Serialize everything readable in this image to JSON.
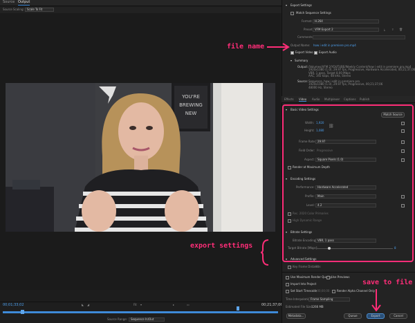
{
  "left": {
    "tabs": [
      "Source",
      "Output"
    ],
    "source_scaling_label": "Source Scaling:",
    "source_scaling_value": "Scale To Fit",
    "timecode_start": "00;01;33;02",
    "timecode_end": "00;21;37;06",
    "fit_label": "Fit",
    "source_range_label": "Source Range:",
    "source_range_value": "Sequence In/Out",
    "poster": {
      "line1": "YOU'RE",
      "line2": "BREWING",
      "line3": "NEW"
    }
  },
  "export": {
    "header": "Export Settings",
    "match_seq": "Match Sequence Settings",
    "format_label": "Format:",
    "format_value": "H.264",
    "preset_label": "Preset:",
    "preset_value": "VFM Export 2",
    "comments_label": "Comments:",
    "output_name_label": "Output Name:",
    "output_name_value": "how i edit in premiere pro.mp4",
    "export_video": "Export Video",
    "export_audio": "Export Audio",
    "summary_header": "Summary",
    "output_label": "Output:",
    "output_lines": [
      "/Volumes/VFM 2/YOUTUBE/Weekly Content/how i edit in premiere pro.mp4",
      "1920x1080 (1.0), 29.97 fps, Progressive, Hardware Accelerated, 00;21;37;06",
      "VBR, 1 pass, Target 8.00 Mbps",
      "AAC, 192 kbps, 48 kHz, Stereo"
    ],
    "source_label": "Source:",
    "source_lines": [
      "Sequence, how i edit in premiere pro",
      "1920x1080 (1.0), 29.97 fps, Progressive, 00;21;37;06",
      "48000 Hz, Stereo"
    ]
  },
  "tabs": [
    "Effects",
    "Video",
    "Audio",
    "Multiplexer",
    "Captions",
    "Publish"
  ],
  "video": {
    "basic_header": "Basic Video Settings",
    "match_source": "Match Source",
    "width_label": "Width:",
    "width_value": "1,920",
    "height_label": "Height:",
    "height_value": "1,080",
    "frame_rate_label": "Frame Rate:",
    "frame_rate_value": "29.97",
    "field_order_label": "Field Order:",
    "field_order_value": "Progressive",
    "aspect_label": "Aspect:",
    "aspect_value": "Square Pixels (1.0)",
    "render_max_depth": "Render at Maximum Depth",
    "encoding_header": "Encoding Settings",
    "performance_label": "Performance:",
    "performance_value": "Hardware Accelerated",
    "profile_label": "Profile:",
    "profile_value": "Main",
    "level_label": "Level:",
    "level_value": "4.2",
    "rec2020": "Rec. 2020 Color Primaries",
    "hdr": "High Dynamic Range",
    "bitrate_header": "Bitrate Settings",
    "bitrate_encoding_label": "Bitrate Encoding:",
    "bitrate_encoding_value": "VBR, 1 pass",
    "target_bitrate_label": "Target Bitrate [Mbps]:",
    "target_bitrate_value": "8",
    "target_bitrate_fraction": 0.16,
    "advanced_header": "Advanced Settings",
    "key_frame_label": "Key Frame Distance:",
    "key_frame_value": "90"
  },
  "bottom": {
    "use_max_render": "Use Maximum Render Quality",
    "use_previews": "Use Previews",
    "import_into_project": "Import Into Project",
    "set_start_timecode": "Set Start Timecode",
    "start_timecode_value": "00;00;00;00",
    "render_alpha": "Render Alpha Channel Only",
    "time_interp_label": "Time Interpolation:",
    "time_interp_value": "Frame Sampling",
    "est_file_size_label": "Estimated File Size:",
    "est_file_size_value": "1266 MB",
    "metadata_btn": "Metadata...",
    "queue_btn": "Queue",
    "export_btn": "Export",
    "cancel_btn": "Cancel"
  },
  "annotations": {
    "file_name": "file name",
    "export_settings": "export settings",
    "save_to_file": "save to file"
  },
  "colors": {
    "accent": "#4ea1f0",
    "annotation": "#ff2d78"
  }
}
